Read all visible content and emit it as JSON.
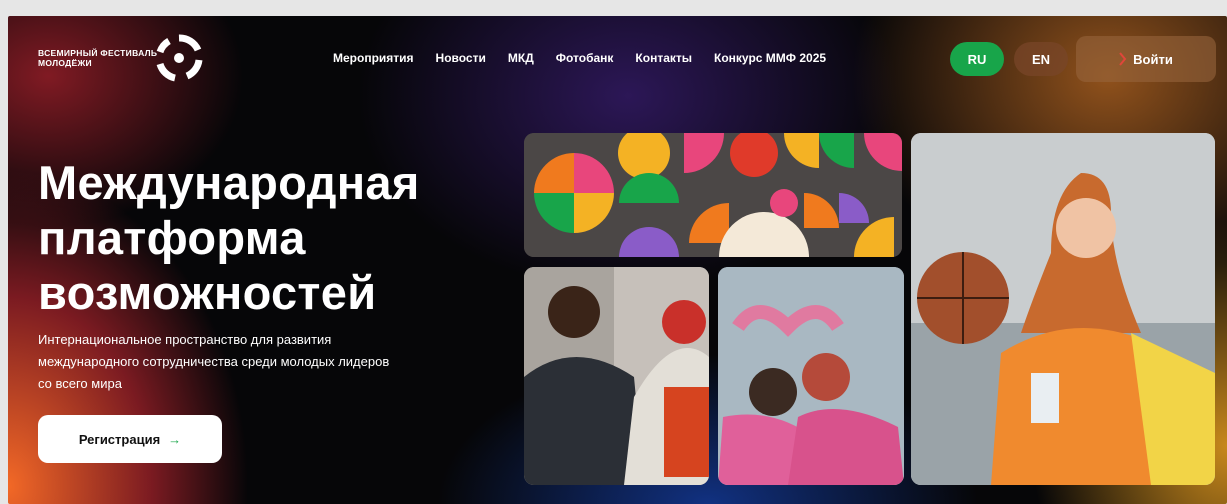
{
  "header": {
    "logo_line1": "ВСЕМИРНЫЙ ФЕСТИВАЛЬ",
    "logo_line2": "МОЛОДЁЖИ",
    "nav": [
      {
        "label": "Мероприятия"
      },
      {
        "label": "Новости"
      },
      {
        "label": "МКД"
      },
      {
        "label": "Фотобанк"
      },
      {
        "label": "Контакты"
      },
      {
        "label": "Конкурс ММФ 2025"
      }
    ],
    "lang_ru": "RU",
    "lang_en": "EN",
    "login_label": "Войти"
  },
  "hero": {
    "title_lines": [
      "Международная",
      "платформа",
      "возможностей"
    ],
    "subtitle_lines": [
      "Интернациональное пространство для развития",
      "международного сотрудничества среди молодых лидеров",
      "со всего мира"
    ],
    "register_label": "Регистрация",
    "register_arrow": "→"
  },
  "colors": {
    "accent_green": "#18a54a",
    "pattern_orange": "#f07a1e",
    "pattern_pink": "#e8467c",
    "pattern_purple": "#8a5cc8",
    "pattern_yellow": "#f4b224",
    "pattern_red": "#e03a2a"
  },
  "icons": [
    "logo-mark-icon",
    "login-icon",
    "arrow-right-icon"
  ]
}
